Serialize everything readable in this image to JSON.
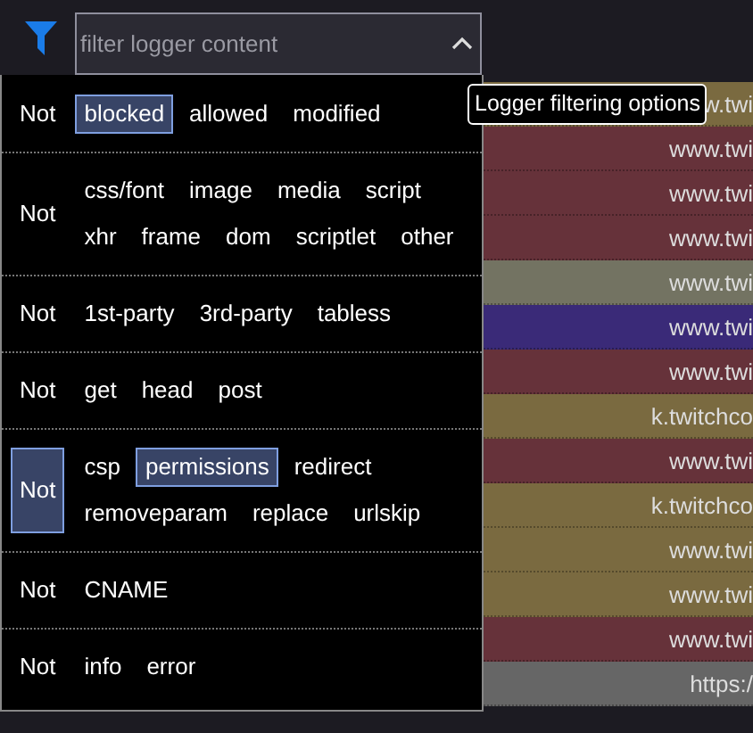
{
  "filter_field": {
    "placeholder": "filter logger content"
  },
  "tooltip": "Logger filtering options",
  "filter_groups": [
    {
      "not": {
        "label": "Not",
        "selected": false
      },
      "lines": [
        [
          {
            "label": "blocked",
            "selected": true
          },
          {
            "label": "allowed",
            "selected": false
          },
          {
            "label": "modified",
            "selected": false
          }
        ]
      ]
    },
    {
      "not": {
        "label": "Not",
        "selected": false
      },
      "lines": [
        [
          {
            "label": "css/font",
            "selected": false
          },
          {
            "label": "image",
            "selected": false
          },
          {
            "label": "media",
            "selected": false
          },
          {
            "label": "script",
            "selected": false
          }
        ],
        [
          {
            "label": "xhr",
            "selected": false
          },
          {
            "label": "frame",
            "selected": false
          },
          {
            "label": "dom",
            "selected": false
          },
          {
            "label": "scriptlet",
            "selected": false
          },
          {
            "label": "other",
            "selected": false
          }
        ]
      ]
    },
    {
      "not": {
        "label": "Not",
        "selected": false
      },
      "lines": [
        [
          {
            "label": "1st-party",
            "selected": false
          },
          {
            "label": "3rd-party",
            "selected": false
          },
          {
            "label": "tabless",
            "selected": false
          }
        ]
      ]
    },
    {
      "not": {
        "label": "Not",
        "selected": false
      },
      "lines": [
        [
          {
            "label": "get",
            "selected": false
          },
          {
            "label": "head",
            "selected": false
          },
          {
            "label": "post",
            "selected": false
          }
        ]
      ]
    },
    {
      "not": {
        "label": "Not",
        "selected": true
      },
      "lines": [
        [
          {
            "label": "csp",
            "selected": false
          },
          {
            "label": "permissions",
            "selected": true
          },
          {
            "label": "redirect",
            "selected": false
          }
        ],
        [
          {
            "label": "removeparam",
            "selected": false
          },
          {
            "label": "replace",
            "selected": false
          },
          {
            "label": "urlskip",
            "selected": false
          }
        ]
      ]
    },
    {
      "not": {
        "label": "Not",
        "selected": false
      },
      "lines": [
        [
          {
            "label": "CNAME",
            "selected": false
          }
        ]
      ]
    },
    {
      "not": {
        "label": "Not",
        "selected": false
      },
      "lines": [
        [
          {
            "label": "info",
            "selected": false
          },
          {
            "label": "error",
            "selected": false
          }
        ]
      ]
    }
  ],
  "log_rows": [
    {
      "text": "w.twi",
      "color": "#7a6a40"
    },
    {
      "text": "www.twi",
      "color": "#66323a"
    },
    {
      "text": "www.twi",
      "color": "#66323a"
    },
    {
      "text": "www.twi",
      "color": "#66323a"
    },
    {
      "text": "www.twi",
      "color": "#737362"
    },
    {
      "text": "www.twi",
      "color": "#3a2a78"
    },
    {
      "text": "www.twi",
      "color": "#66323a"
    },
    {
      "text": "k.twitchco",
      "color": "#7a6a40"
    },
    {
      "text": "www.twi",
      "color": "#66323a"
    },
    {
      "text": "k.twitchco",
      "color": "#7a6a40"
    },
    {
      "text": "www.twi",
      "color": "#7a6a40"
    },
    {
      "text": "www.twi",
      "color": "#7a6a40"
    },
    {
      "text": "www.twi",
      "color": "#66323a"
    },
    {
      "text": "https:/",
      "color": "#666666"
    }
  ]
}
